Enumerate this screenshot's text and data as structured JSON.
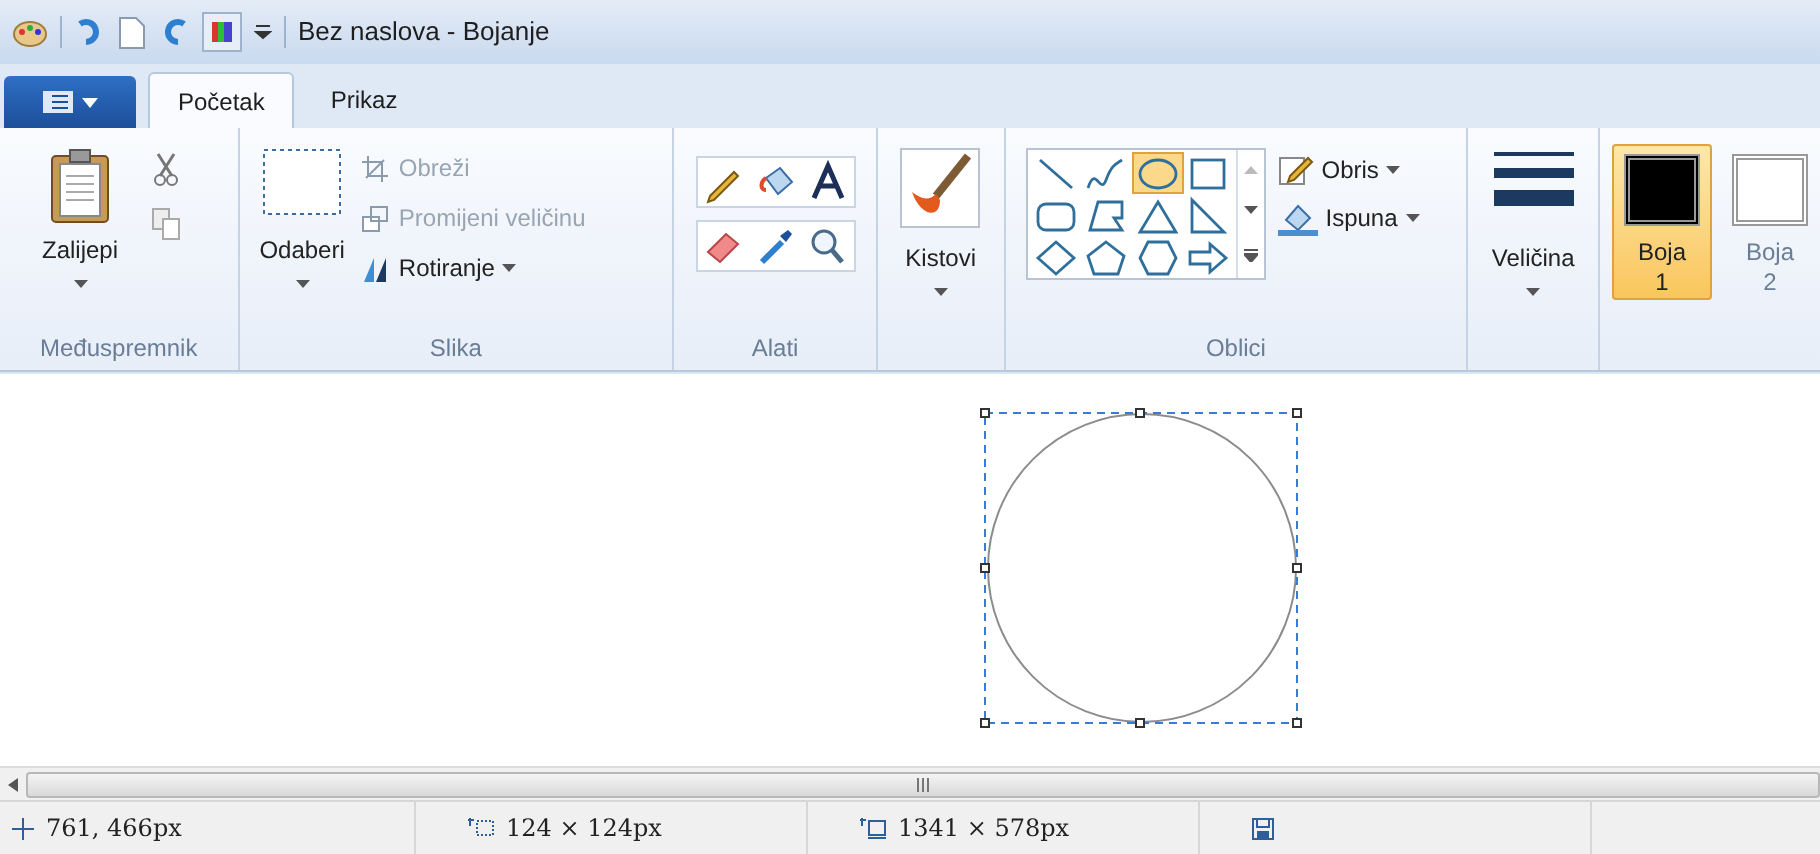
{
  "window": {
    "title": "Bez naslova - Bojanje"
  },
  "tabs": [
    {
      "label": "Početak",
      "selected": true
    },
    {
      "label": "Prikaz",
      "selected": false
    }
  ],
  "ribbon": {
    "clipboard": {
      "label": "Međuspremnik",
      "paste": "Zalijepi"
    },
    "image": {
      "label": "Slika",
      "select": "Odaberi",
      "items": [
        {
          "kind": "crop",
          "label": "Obreži",
          "disabled": true,
          "dropdown": false
        },
        {
          "kind": "resize",
          "label": "Promijeni veličinu",
          "disabled": true,
          "dropdown": false
        },
        {
          "kind": "rotate",
          "label": "Rotiranje",
          "disabled": false,
          "dropdown": true
        }
      ]
    },
    "tools": {
      "label": "Alati"
    },
    "brushes": {
      "label": "Kistovi"
    },
    "shapes": {
      "label": "Oblici",
      "gallery": [
        {
          "kind": "line",
          "selected": false
        },
        {
          "kind": "curve",
          "selected": false
        },
        {
          "kind": "oval",
          "selected": true
        },
        {
          "kind": "rectangle",
          "selected": false
        },
        {
          "kind": "rounded-rectangle",
          "selected": false
        },
        {
          "kind": "polygon",
          "selected": false
        },
        {
          "kind": "triangle",
          "selected": false
        },
        {
          "kind": "right-triangle",
          "selected": false
        },
        {
          "kind": "diamond",
          "selected": false
        },
        {
          "kind": "pentagon",
          "selected": false
        },
        {
          "kind": "hexagon",
          "selected": false
        },
        {
          "kind": "arrow",
          "selected": false
        }
      ],
      "outline": "Obris",
      "fill": "Ispuna"
    },
    "size": {
      "label": "Veličina"
    },
    "colors": [
      {
        "label": "Boja",
        "number": "1",
        "selected": true,
        "color": "#000000"
      },
      {
        "label": "Boja",
        "number": "2",
        "selected": false,
        "color": "#ffffff"
      }
    ]
  },
  "status_bar": {
    "cursor": "761, 466px",
    "selection": "124 × 124px",
    "canvas_size": "1341 × 578px"
  }
}
